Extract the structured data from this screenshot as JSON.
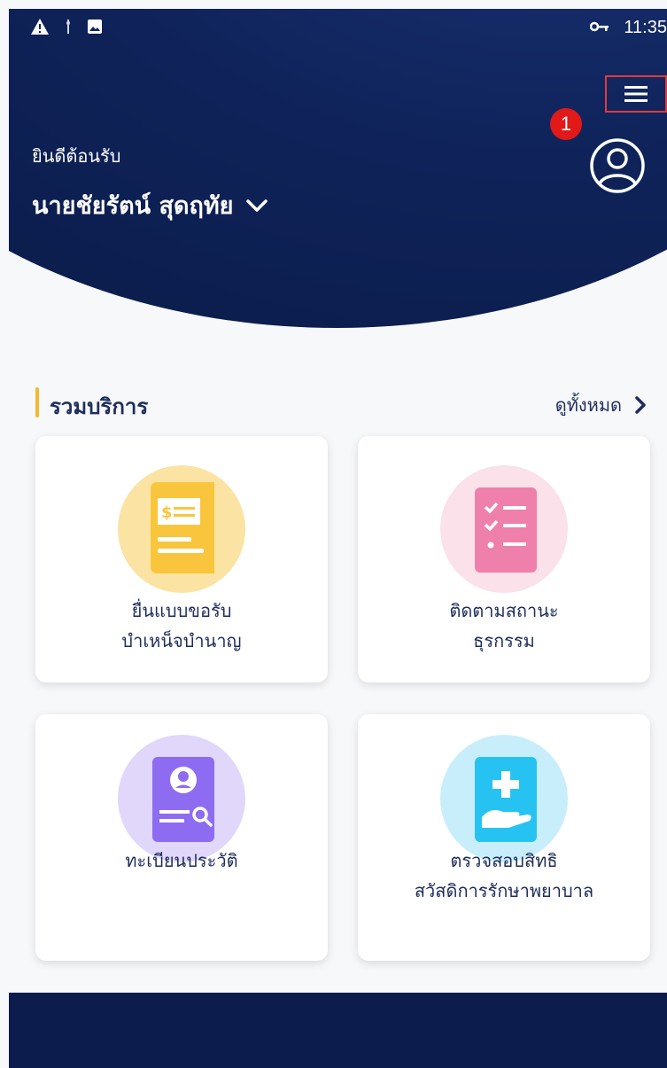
{
  "status_bar": {
    "time": "11:35"
  },
  "header": {
    "welcome": "ยินดีต้อนรับ",
    "user_name": "นายชัยรัตน์ สุดฤทัย",
    "badge": "1"
  },
  "section": {
    "title": "รวมบริการ",
    "see_all": "ดูทั้งหมด"
  },
  "cards": [
    {
      "line1": "ยื่นแบบขอรับ",
      "line2": "บำเหน็จบำนาญ"
    },
    {
      "line1": "ติดตามสถานะ",
      "line2": "ธุรกรรม"
    },
    {
      "line1": "ทะเบียนประวัติ",
      "line2": ""
    },
    {
      "line1": "ตรวจสอบสิทธิ",
      "line2": "สวัสดิการรักษาพยาบาล"
    }
  ],
  "colors": {
    "header_navy": "#0f235a",
    "accent_yellow": "#f5b82e",
    "menu_highlight": "#e23a3a",
    "badge_red": "#e11919",
    "text_navy": "#1e2d5c"
  }
}
